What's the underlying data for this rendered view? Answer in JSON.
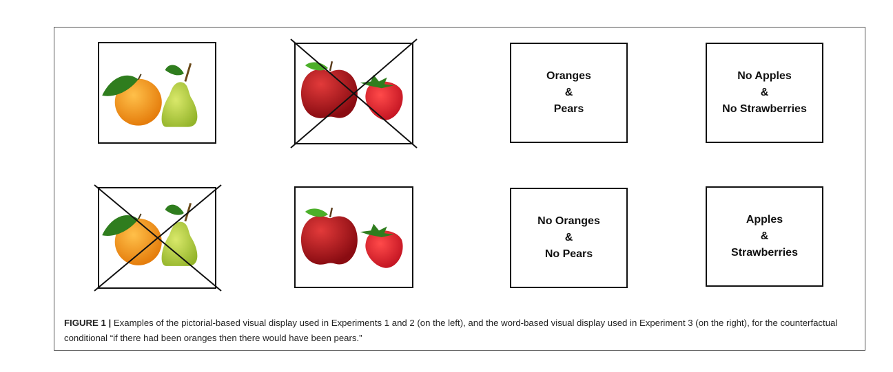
{
  "figure": {
    "cells": [
      {
        "id": "r1c1",
        "kind": "picture",
        "fruits": "oranges-pears",
        "crossed": false
      },
      {
        "id": "r1c2",
        "kind": "picture",
        "fruits": "apples-strawberries",
        "crossed": true
      },
      {
        "id": "r1c3",
        "kind": "words",
        "lines": [
          "Oranges",
          "&",
          "Pears"
        ]
      },
      {
        "id": "r1c4",
        "kind": "words",
        "lines": [
          "No Apples",
          "&",
          "No Strawberries"
        ]
      },
      {
        "id": "r2c1",
        "kind": "picture",
        "fruits": "oranges-pears",
        "crossed": true
      },
      {
        "id": "r2c2",
        "kind": "picture",
        "fruits": "apples-strawberries",
        "crossed": false
      },
      {
        "id": "r2c3",
        "kind": "words",
        "lines": [
          "No Oranges",
          "&",
          "No Pears"
        ]
      },
      {
        "id": "r2c4",
        "kind": "words",
        "lines": [
          "Apples",
          "&",
          "Strawberries"
        ]
      }
    ],
    "caption": {
      "label": "FIGURE 1 |",
      "text": " Examples of the pictorial-based visual display used in Experiments 1 and 2 (on the left), and the word-based visual display used in Experiment 3 (on the right), for the counterfactual conditional “if there had been oranges then there would have been pears.”"
    }
  },
  "colors": {
    "orange": "#f59a1c",
    "pear": "#b8d24a",
    "apple": "#b5151f",
    "strawberry": "#e0222e",
    "leaf": "#2f7d1e"
  }
}
